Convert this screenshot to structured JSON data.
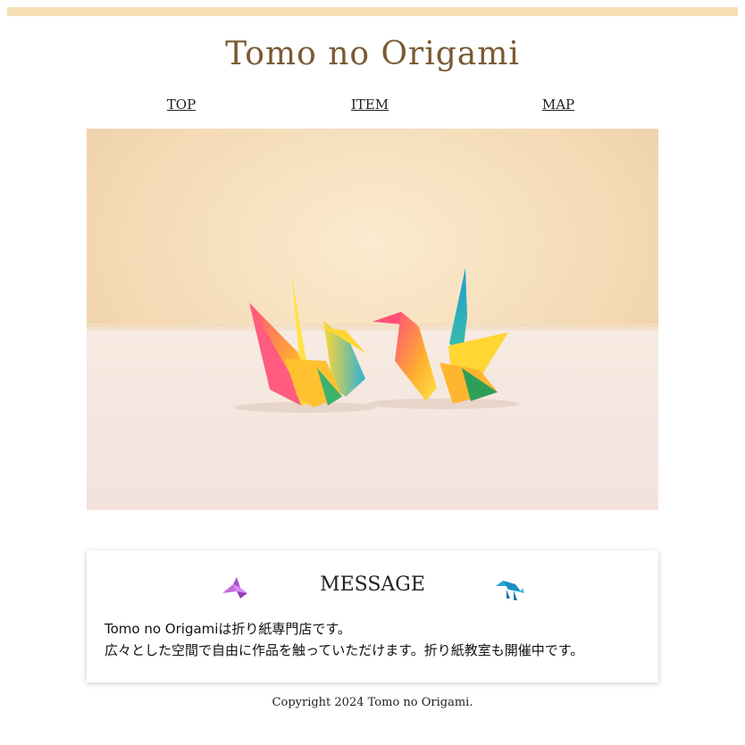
{
  "site": {
    "title": "Tomo no Origami"
  },
  "nav": {
    "items": [
      {
        "label": "TOP"
      },
      {
        "label": "ITEM"
      },
      {
        "label": "MAP"
      }
    ]
  },
  "hero": {
    "icon": "origami-cranes-photo"
  },
  "message": {
    "title": "MESSAGE",
    "left_icon": "purple-origami-bird-icon",
    "right_icon": "blue-origami-dinosaur-icon",
    "lines": [
      "Tomo no Origamiは折り紙専門店です。",
      "広々とした空間で自由に作品を触っていただけます。折り紙教室も開催中です。"
    ]
  },
  "footer": {
    "copyright": "Copyright 2024 Tomo no Origami."
  },
  "colors": {
    "topbar": "#f6dfb4",
    "title": "#7a5a33"
  }
}
